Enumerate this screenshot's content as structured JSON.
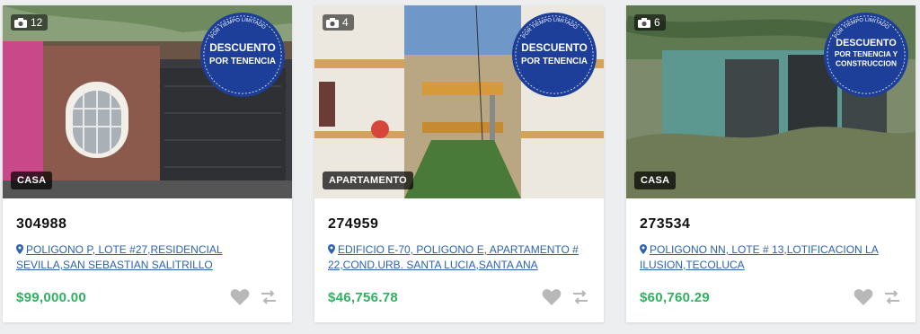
{
  "listings": [
    {
      "photo_count": "12",
      "badge_lines": [
        "DESCUENTO",
        "POR TENENCIA"
      ],
      "badge_ring": "POR TIEMPO LIMITADO",
      "type": "CASA",
      "code": "304988",
      "address": "POLIGONO P, LOTE #27,RESIDENCIAL SEVILLA,SAN SEBASTIAN SALITRILLO",
      "price": "$99,000.00"
    },
    {
      "photo_count": "4",
      "badge_lines": [
        "DESCUENTO",
        "POR TENENCIA"
      ],
      "badge_ring": "POR TIEMPO LIMITADO",
      "type": "APARTAMENTO",
      "code": "274959",
      "address": "EDIFICIO E-70, POLIGONO E, APARTAMENTO # 22,COND.URB. SANTA LUCIA,SANTA ANA",
      "price": "$46,756.78"
    },
    {
      "photo_count": "6",
      "badge_lines": [
        "DESCUENTO",
        "POR TENENCIA Y",
        "CONSTRUCCION"
      ],
      "badge_ring": "POR TIEMPO LIMITADO",
      "type": "CASA",
      "code": "273534",
      "address": "POLIGONO NN, LOTE # 13,LOTIFICACION LA ILUSION,TECOLUCA",
      "price": "$60,760.29"
    }
  ],
  "colors": {
    "price": "#2db260",
    "link": "#2b63b0",
    "badge": "#1d3f9a",
    "icon": "#b8b8b8"
  },
  "icons": {
    "photos": "camera-icon",
    "location": "map-pin-icon",
    "favorite": "heart-icon",
    "compare": "compare-arrows-icon"
  }
}
